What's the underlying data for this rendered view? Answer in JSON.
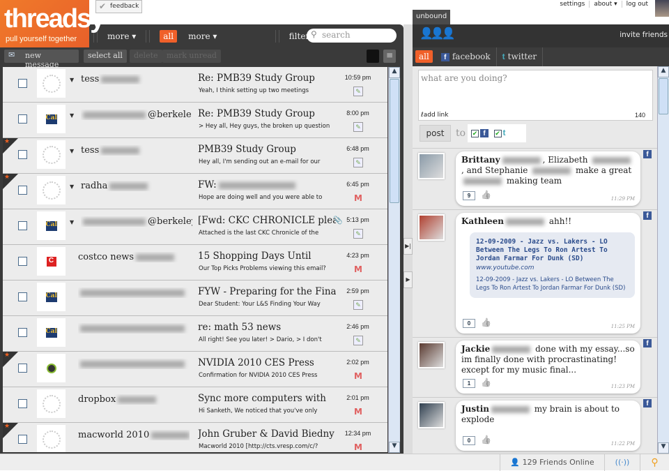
{
  "logo": {
    "name": "threadsy",
    "tagline": "pull yourself together"
  },
  "feedback": "feedback",
  "topnav": {
    "settings": "settings",
    "about": "about ▾",
    "logout": "log out"
  },
  "toolbar": {
    "more1": "more ▾",
    "all": "all",
    "more2": "more ▾",
    "filter": "filter ▾",
    "search_placeholder": "search"
  },
  "actions": {
    "new_message": "new message",
    "select_all": "select all",
    "delete": "delete",
    "mark_unread": "mark unread"
  },
  "emails": [
    {
      "starred": false,
      "avatar": "default",
      "sender": "tess",
      "sender_suffix": "",
      "subject": "Re: PMB39 Study Group",
      "preview": "Yeah, I think setting up two meetings",
      "time": "10:59 pm",
      "source": "doc",
      "attach": false,
      "thread": true
    },
    {
      "starred": false,
      "avatar": "cal",
      "sender": "",
      "sender_suffix": "@berkele",
      "subject": "Re: PMB39 Study Group",
      "preview": "> Hey all, Hey guys, the broken up question",
      "time": "8:00 pm",
      "source": "doc",
      "attach": false,
      "thread": true
    },
    {
      "starred": true,
      "avatar": "default",
      "sender": "tess",
      "sender_suffix": "",
      "subject": "PMB39 Study Group",
      "preview": "Hey all, I'm sending out an e-mail for our",
      "time": "6:48 pm",
      "source": "doc",
      "attach": false,
      "thread": true
    },
    {
      "starred": true,
      "avatar": "default",
      "sender": "radha",
      "sender_suffix": "",
      "subject": "FW:",
      "preview": "Hope are doing well and you were able to",
      "time": "6:45 pm",
      "source": "gmail",
      "attach": false,
      "thread": true
    },
    {
      "starred": false,
      "avatar": "cal",
      "sender": "",
      "sender_suffix": "@berkeley.ec",
      "subject": "[Fwd: CKC CHRONICLE please",
      "preview": "Attached is the last CKC Chronicle of the",
      "time": "5:13 pm",
      "source": "doc",
      "attach": true,
      "thread": true
    },
    {
      "starred": false,
      "avatar": "costco",
      "sender": "costco news",
      "sender_suffix": "",
      "subject": "15 Shopping Days Until",
      "preview": "Our Top Picks Problems viewing this email?",
      "time": "4:23 pm",
      "source": "gmail",
      "attach": false,
      "thread": false
    },
    {
      "starred": false,
      "avatar": "cal",
      "sender": "",
      "sender_suffix": "",
      "subject": "FYW - Preparing for the Finals",
      "preview": "Dear Student: Your L&S Finding Your Way",
      "time": "2:59 pm",
      "source": "doc",
      "attach": false,
      "thread": false
    },
    {
      "starred": false,
      "avatar": "cal",
      "sender": "",
      "sender_suffix": "",
      "subject": "re: math 53 news",
      "preview": "All right! See you later! > Dario, > I don't",
      "time": "2:46 pm",
      "source": "doc",
      "attach": false,
      "thread": false
    },
    {
      "starred": true,
      "avatar": "nvidia",
      "sender": "",
      "sender_suffix": "",
      "subject": "NVIDIA 2010 CES Press",
      "preview": "Confirmation for NVIDIA 2010 CES Press",
      "time": "2:02 pm",
      "source": "gmail",
      "attach": false,
      "thread": false
    },
    {
      "starred": false,
      "avatar": "default",
      "sender": "dropbox",
      "sender_suffix": "",
      "subject": "Sync more computers with",
      "preview": "Hi Sanketh, We noticed that you've only",
      "time": "2:01 pm",
      "source": "gmail",
      "attach": false,
      "thread": false
    },
    {
      "starred": true,
      "avatar": "default",
      "sender": "macworld 2010",
      "sender_suffix": "",
      "subject": "John Gruber & David Biedny To",
      "preview": "Macworld 2010 [http://cts.vresp.com/c/?",
      "time": "12:34 pm",
      "source": "gmail",
      "attach": false,
      "thread": false
    }
  ],
  "social": {
    "tab": "unbound",
    "invite": "invite friends",
    "tabs": {
      "all": "all",
      "facebook": "facebook",
      "twitter": "twitter"
    },
    "compose_placeholder": "what are you doing?",
    "add_link": "add link",
    "char_count": "140",
    "post": "post",
    "to": "to"
  },
  "posts": [
    {
      "html_parts": [
        {
          "b": "Brittany"
        },
        {
          "blur": 1
        },
        {
          "t": ", Elizabeth "
        },
        {
          "blur": 1
        },
        {
          "t": ", and Stephanie "
        },
        {
          "blur": 1
        },
        {
          "t": " make a great "
        },
        {
          "blur": 1
        },
        {
          "t": " making team"
        }
      ],
      "comments": "9",
      "time": "11:29 PM",
      "avatar": "#8a9aa8"
    },
    {
      "html_parts": [
        {
          "b": "Kathleen"
        },
        {
          "blur": 1
        },
        {
          "t": " ahh!!"
        }
      ],
      "link": {
        "title": "12-09-2009 - Jazz vs. Lakers - LO Between The Legs To Ron Artest To Jordan Farmar For Dunk (SD)",
        "url": "www.youtube.com",
        "desc": "12-09-2009 - Jazz vs. Lakers - LO Between The Legs To Ron Artest To Jordan Farmar For Dunk (SD)"
      },
      "comments": "0",
      "time": "11:25 PM",
      "avatar": "#b04030"
    },
    {
      "html_parts": [
        {
          "b": "Jackie"
        },
        {
          "blur": 1
        },
        {
          "t": " done with my essay...so im finally done with procrastinating! except for my music final..."
        }
      ],
      "comments": "1",
      "time": "11:23 PM",
      "avatar": "#5a3a30"
    },
    {
      "html_parts": [
        {
          "b": "Justin"
        },
        {
          "blur": 1
        },
        {
          "t": " my brain is about to explode"
        }
      ],
      "comments": "0",
      "time": "11:22 PM",
      "avatar": "#304050"
    }
  ],
  "status": {
    "friends_online": "129 Friends Online"
  },
  "colors": {
    "accent": "#f0602a",
    "dark": "#3a3a3a",
    "facebook": "#3b5998"
  }
}
